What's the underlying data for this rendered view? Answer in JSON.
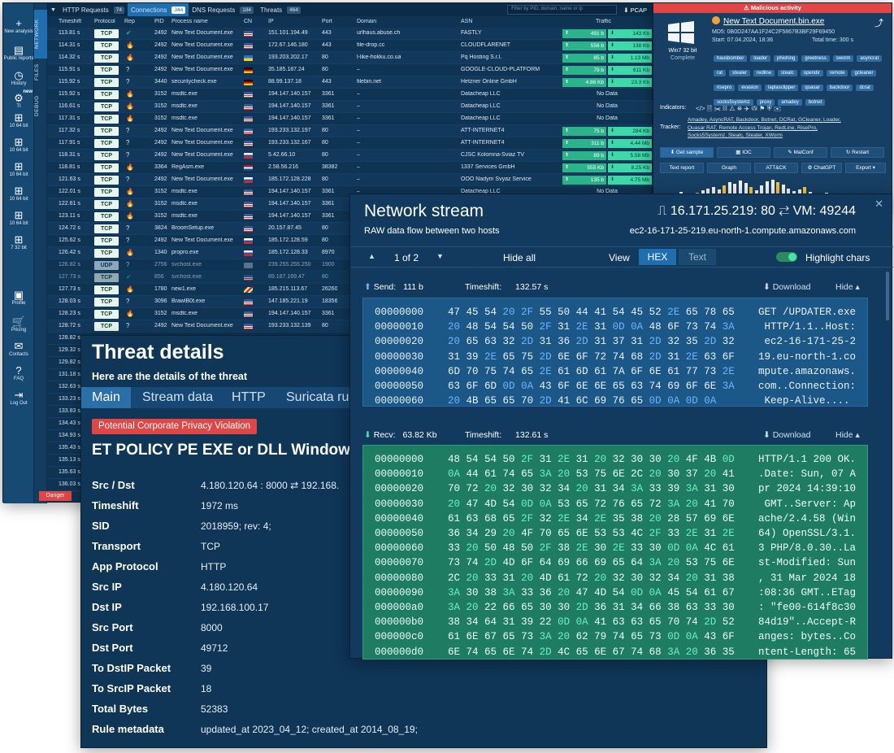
{
  "main": {
    "sidebar": [
      {
        "icon": "+",
        "label": "New analysis"
      },
      {
        "icon": "▤",
        "label": "Public reports"
      },
      {
        "icon": "◷",
        "label": "History"
      },
      {
        "icon": "⚙",
        "label": "TI",
        "badge": "new"
      },
      {
        "icon": "⊞",
        "label": "10 64 bit"
      },
      {
        "icon": "⊞",
        "label": "10 64 bit"
      },
      {
        "icon": "⊞",
        "label": "10 64 bit"
      },
      {
        "icon": "⊞",
        "label": "10 64 bit"
      },
      {
        "icon": "⊞",
        "label": "10 64 bit"
      },
      {
        "icon": "⊞",
        "label": "7 32 bit"
      },
      {
        "icon": "▣",
        "label": "Profile"
      },
      {
        "icon": "🛒",
        "label": "Pricing"
      },
      {
        "icon": "✉",
        "label": "Contacts"
      },
      {
        "icon": "?",
        "label": "FAQ"
      },
      {
        "icon": "⇥",
        "label": "Log Out"
      }
    ],
    "vtabs": [
      "NETWORK",
      "FILES",
      "DEBUG"
    ],
    "tabs": [
      {
        "label": "HTTP Requests",
        "count": "74"
      },
      {
        "label": "Connections",
        "count": "344",
        "active": true
      },
      {
        "label": "DNS Requests",
        "count": "184"
      },
      {
        "label": "Threats",
        "count": "464"
      }
    ],
    "filter_placeholder": "Filter by PID, domain, name or ip",
    "pcap_label": "PCAP",
    "headers": {
      "ts": "Timeshift",
      "proto": "Protocol",
      "rep": "Rep",
      "pid": "PID",
      "proc": "Process name",
      "cn": "CN",
      "ip": "IP",
      "port": "Port",
      "domain": "Domain",
      "asn": "ASN",
      "traffic": "Traffic"
    },
    "rows": [
      {
        "ts": "113.81 s",
        "proto": "TCP",
        "rep": "ok",
        "pid": "2492",
        "proc": "New Text Document.exe",
        "flag": "us",
        "ip": "151.101.194.49",
        "port": "443",
        "domain": "urlhaus.abuse.ch",
        "asn": "FASTLY",
        "up": "491 b",
        "dn": "143 Kb"
      },
      {
        "ts": "114.31 s",
        "proto": "TCP",
        "rep": "bad",
        "pid": "2492",
        "proc": "New Text Document.exe",
        "flag": "us",
        "ip": "172.67.146.180",
        "port": "443",
        "domain": "file-drop.cc",
        "asn": "CLOUDFLARENET",
        "up": "556 b",
        "dn": "138 Kb"
      },
      {
        "ts": "114.32 s",
        "proto": "TCP",
        "rep": "bad",
        "pid": "2492",
        "proc": "New Text Document.exe",
        "flag": "ua",
        "ip": "193.203.202.17",
        "port": "80",
        "domain": "l-like-hokku.co.ua",
        "asn": "Pq Hosting S.r.l.",
        "up": "85 b",
        "dn": "1.13 Mb"
      },
      {
        "ts": "115.91 s",
        "proto": "TCP",
        "rep": "q",
        "pid": "2492",
        "proc": "New Text Document.exe",
        "flag": "de",
        "ip": "35.185.187.24",
        "port": "80",
        "domain": "–",
        "asn": "GOOGLE-CLOUD-PLATFORM",
        "up": "79 b",
        "dn": "611 Kb"
      },
      {
        "ts": "115.92 s",
        "proto": "TCP",
        "rep": "q",
        "pid": "3440",
        "proc": "securitycheck.exe",
        "flag": "de",
        "ip": "88.99.137.18",
        "port": "443",
        "domain": "filebin.net",
        "asn": "Hetzner Online GmbH",
        "up": "4.86 Kb",
        "dn": "23.3 Kb"
      },
      {
        "ts": "115.92 s",
        "proto": "TCP",
        "rep": "bad",
        "pid": "3152",
        "proc": "msdtc.exe",
        "flag": "us",
        "ip": "194.147.140.157",
        "port": "3361",
        "domain": "–",
        "asn": "Datacheap LLC",
        "nodata": "No Data"
      },
      {
        "ts": "116.61 s",
        "proto": "TCP",
        "rep": "bad",
        "pid": "3152",
        "proc": "msdtc.exe",
        "flag": "us",
        "ip": "194.147.140.157",
        "port": "3361",
        "domain": "–",
        "asn": "Datacheap LLC",
        "nodata": "No Data"
      },
      {
        "ts": "117.31 s",
        "proto": "TCP",
        "rep": "bad",
        "pid": "3152",
        "proc": "msdtc.exe",
        "flag": "us",
        "ip": "194.147.140.157",
        "port": "3361",
        "domain": "–",
        "asn": "Datacheap LLC",
        "nodata": "No Data"
      },
      {
        "ts": "117.32 s",
        "proto": "TCP",
        "rep": "q",
        "pid": "2492",
        "proc": "New Text Document.exe",
        "flag": "us",
        "ip": "193.233.132.197",
        "port": "80",
        "domain": "–",
        "asn": "ATT-INTERNET4",
        "up": "75 b",
        "dn": "284 Kb"
      },
      {
        "ts": "117.91 s",
        "proto": "TCP",
        "rep": "q",
        "pid": "2492",
        "proc": "New Text Document.exe",
        "flag": "us",
        "ip": "193.233.132.167",
        "port": "80",
        "domain": "–",
        "asn": "ATT-INTERNET4",
        "up": "311 b",
        "dn": "4.44 Mb"
      },
      {
        "ts": "118.31 s",
        "proto": "TCP",
        "rep": "q",
        "pid": "2492",
        "proc": "New Text Document.exe",
        "flag": "ru",
        "ip": "5.42.66.10",
        "port": "80",
        "domain": "–",
        "asn": "CJSC Kolomna-Sviaz TV",
        "up": "89 b",
        "dn": "5.58 Mb"
      },
      {
        "ts": "118.81 s",
        "proto": "TCP",
        "rep": "bad",
        "pid": "3364",
        "proc": "RegAsm.exe",
        "flag": "nl",
        "ip": "2.58.56.216",
        "port": "38382",
        "domain": "–",
        "asn": "1337 Services GmbH",
        "up": "555 Kb",
        "dn": "8.25 Kb"
      },
      {
        "ts": "121.63 s",
        "proto": "TCP",
        "rep": "q",
        "pid": "2492",
        "proc": "New Text Document.exe",
        "flag": "ru",
        "ip": "185.172.128.228",
        "port": "80",
        "domain": "–",
        "asn": "OOO Nadym Svyaz Service",
        "up": "135 b",
        "dn": "4.75 Mb"
      },
      {
        "ts": "122.01 s",
        "proto": "TCP",
        "rep": "bad",
        "pid": "3152",
        "proc": "msdtc.exe",
        "flag": "us",
        "ip": "194.147.140.157",
        "port": "3361",
        "domain": "–",
        "asn": "Datacheap LLC",
        "nodata": "No Data"
      },
      {
        "ts": "122.61 s",
        "proto": "TCP",
        "rep": "bad",
        "pid": "3152",
        "proc": "msdtc.exe",
        "flag": "us",
        "ip": "194.147.140.157",
        "port": "3361",
        "domain": "",
        "asn": "",
        "nodata": ""
      },
      {
        "ts": "123.11 s",
        "proto": "TCP",
        "rep": "bad",
        "pid": "3152",
        "proc": "msdtc.exe",
        "flag": "us",
        "ip": "194.147.140.157",
        "port": "3361",
        "domain": "",
        "asn": "",
        "nodata": ""
      },
      {
        "ts": "124.72 s",
        "proto": "TCP",
        "rep": "q",
        "pid": "3824",
        "proc": "BroomSetup.exe",
        "flag": "us",
        "ip": "20.157.87.45",
        "port": "80",
        "domain": "",
        "asn": "",
        "nodata": ""
      },
      {
        "ts": "125.62 s",
        "proto": "TCP",
        "rep": "q",
        "pid": "2492",
        "proc": "New Text Document.exe",
        "flag": "ru",
        "ip": "185.172.128.59",
        "port": "80",
        "domain": "",
        "asn": "",
        "nodata": ""
      },
      {
        "ts": "126.42 s",
        "proto": "TCP",
        "rep": "bad",
        "pid": "1340",
        "proc": "propro.exe",
        "flag": "ru",
        "ip": "185.172.128.33",
        "port": "8970",
        "domain": "",
        "asn": "",
        "nodata": ""
      },
      {
        "ts": "126.82 s",
        "proto": "UDP",
        "rep": "q",
        "pid": "2756",
        "proc": "svchost.exe",
        "flag": "unk",
        "ip": "239.255.255.250",
        "port": "1900",
        "domain": "",
        "asn": "",
        "nodata": "",
        "dim": true
      },
      {
        "ts": "127.73 s",
        "proto": "TCP",
        "rep": "ok",
        "pid": "856",
        "proc": "svchost.exe",
        "flag": "us",
        "ip": "89.187.169.47",
        "port": "80",
        "domain": "",
        "asn": "",
        "nodata": "",
        "dim": true
      },
      {
        "ts": "127.73 s",
        "proto": "TCP",
        "rep": "bad",
        "pid": "1780",
        "proc": "new1.exe",
        "flag": "sc",
        "ip": "185.215.113.67",
        "port": "26260",
        "domain": "",
        "asn": "",
        "nodata": ""
      },
      {
        "ts": "128.03 s",
        "proto": "TCP",
        "rep": "q",
        "pid": "3096",
        "proc": "BrawlB0t.exe",
        "flag": "us",
        "ip": "147.185.221.19",
        "port": "18356",
        "domain": "",
        "asn": "",
        "nodata": ""
      },
      {
        "ts": "128.23 s",
        "proto": "TCP",
        "rep": "bad",
        "pid": "3152",
        "proc": "msdtc.exe",
        "flag": "us",
        "ip": "194.147.140.157",
        "port": "3361",
        "domain": "",
        "asn": "",
        "nodata": ""
      },
      {
        "ts": "128.72 s",
        "proto": "TCP",
        "rep": "q",
        "pid": "2492",
        "proc": "New Text Document.exe",
        "flag": "us",
        "ip": "193.233.132.139",
        "port": "80",
        "domain": "",
        "asn": "",
        "nodata": ""
      }
    ],
    "extra_ts": [
      "128.82 s",
      "129.32 s",
      "129.82 s",
      "131.18 s",
      "132.63 s",
      "133.23 s",
      "133.83 s",
      "134.43 s",
      "134.93 s",
      "135.43 s",
      "135.13 s",
      "135.63 s",
      "136.03 s"
    ],
    "danger_label": "Danger"
  },
  "rightpanel": {
    "header": "Malicious activity",
    "os": "Win7 32 bit",
    "status": "Complete",
    "file": "New Text Document.bin.exe",
    "md5": "MD5: 0B0D247AA1F24C2F5867B3BF29F69450",
    "start": "Start: 07.04.2024, 18:36",
    "total": "Total time: 300 s",
    "tags": [
      "hausbomber",
      "loader",
      "phishing",
      "greetness",
      "sworm",
      "asyncrat",
      "rat",
      "stealer",
      "redline",
      "stealc",
      "opendir",
      "remote",
      "gcleaner",
      "risepro",
      "evasion",
      "laplasclipper",
      "quasar",
      "backdoor",
      "dcrat",
      "socks5systemz",
      "proxy",
      "amadey",
      "botnet"
    ],
    "indicators_label": "Indicators:",
    "indicator_icons": "</>  🗎  ✂  ⛓  ⚠  ⛯  ✈  ⛁  ⚑  ⛨  ✉",
    "families": "Amadey, AsyncRAT, Backdoor, Botnet, DCRat, GCleaner, Loader,",
    "tracker_label": "Tracker:",
    "tracker_line1": "Quasar RAT, Remote Access Trojan, RedLine, RisePro,",
    "tracker_line2": "Socks5Systemz, Stealc, Stealer, XWorm",
    "btn": {
      "sample": "Get sample",
      "ioc": "IOC",
      "malconf": "MalConf",
      "restart": "Restart",
      "report": "Text report",
      "graph": "Graph",
      "attck": "ATT&CK",
      "chatgpt": "ChatGPT",
      "export": "Export"
    }
  },
  "stream": {
    "title": "Network stream",
    "subtitle": "RAW data flow between two hosts",
    "endpoint": "16.171.25.219: 80 ⇄ VM: 49244",
    "host": "ec2-16-171-25-219.eu-north-1.compute.amazonaws.com",
    "pager": "1 of 2",
    "hide_all": "Hide all",
    "view": "View",
    "hex": "HEX",
    "text": "Text",
    "highlight": "Highlight chars",
    "send": {
      "label": "Send:",
      "size": "111 b",
      "ts_label": "Timeshift:",
      "ts": "132.57 s",
      "download": "Download",
      "hide": "Hide"
    },
    "recv": {
      "label": "Recv:",
      "size": "63.82 Kb",
      "ts_label": "Timeshift:",
      "ts": "132.61 s",
      "download": "Download",
      "hide": "Hide"
    },
    "send_rows": [
      {
        "off": "00000000",
        "hex": "47 45 54 20 2F 55 50 44 41 54 45 52 2E 65 78 65",
        "txt": "GET /UPDATER.exe"
      },
      {
        "off": "00000010",
        "hex": "20 48 54 54 50 2F 31 2E 31 0D 0A 48 6F 73 74 3A",
        "txt": " HTTP/1.1..Host:"
      },
      {
        "off": "00000020",
        "hex": "20 65 63 32 2D 31 36 2D 31 37 31 2D 32 35 2D 32",
        "txt": " ec2-16-171-25-2"
      },
      {
        "off": "00000030",
        "hex": "31 39 2E 65 75 2D 6E 6F 72 74 68 2D 31 2E 63 6F",
        "txt": "19.eu-north-1.co"
      },
      {
        "off": "00000040",
        "hex": "6D 70 75 74 65 2E 61 6D 61 7A 6F 6E 61 77 73 2E",
        "txt": "mpute.amazonaws."
      },
      {
        "off": "00000050",
        "hex": "63 6F 6D 0D 0A 43 6F 6E 6E 65 63 74 69 6F 6E 3A",
        "txt": "com..Connection:"
      },
      {
        "off": "00000060",
        "hex": "20 4B 65 65 70 2D 41 6C 69 76 65 0D 0A 0D 0A",
        "txt": " Keep-Alive...."
      }
    ],
    "recv_rows": [
      {
        "off": "00000000",
        "hex": "48 54 54 50 2F 31 2E 31 20 32 30 30 20 4F 4B 0D",
        "txt": "HTTP/1.1 200 OK."
      },
      {
        "off": "00000010",
        "hex": "0A 44 61 74 65 3A 20 53 75 6E 2C 20 30 37 20 41",
        "txt": ".Date: Sun, 07 A"
      },
      {
        "off": "00000020",
        "hex": "70 72 20 32 30 32 34 20 31 34 3A 33 39 3A 31 30",
        "txt": "pr 2024 14:39:10"
      },
      {
        "off": "00000030",
        "hex": "20 47 4D 54 0D 0A 53 65 72 76 65 72 3A 20 41 70",
        "txt": " GMT..Server: Ap"
      },
      {
        "off": "00000040",
        "hex": "61 63 68 65 2F 32 2E 34 2E 35 38 20 28 57 69 6E",
        "txt": "ache/2.4.58 (Win"
      },
      {
        "off": "00000050",
        "hex": "36 34 29 20 4F 70 65 6E 53 53 4C 2F 33 2E 31 2E",
        "txt": "64) OpenSSL/3.1."
      },
      {
        "off": "00000060",
        "hex": "33 20 50 48 50 2F 38 2E 30 2E 33 30 0D 0A 4C 61",
        "txt": "3 PHP/8.0.30..La"
      },
      {
        "off": "00000070",
        "hex": "73 74 2D 4D 6F 64 69 66 69 65 64 3A 20 53 75 6E",
        "txt": "st-Modified: Sun"
      },
      {
        "off": "00000080",
        "hex": "2C 20 33 31 20 4D 61 72 20 32 30 32 34 20 31 38",
        "txt": ", 31 Mar 2024 18"
      },
      {
        "off": "00000090",
        "hex": "3A 30 38 3A 33 36 20 47 4D 54 0D 0A 45 54 61 67",
        "txt": ":08:36 GMT..ETag"
      },
      {
        "off": "000000a0",
        "hex": "3A 20 22 66 65 30 30 2D 36 31 34 66 38 63 33 30",
        "txt": ": \"fe00-614f8c30"
      },
      {
        "off": "000000b0",
        "hex": "38 34 64 31 39 22 0D 0A 41 63 63 65 70 74 2D 52",
        "txt": "84d19\"..Accept-R"
      },
      {
        "off": "000000c0",
        "hex": "61 6E 67 65 73 3A 20 62 79 74 65 73 0D 0A 43 6F",
        "txt": "anges: bytes..Co"
      },
      {
        "off": "000000d0",
        "hex": "6E 74 65 6E 74 2D 4C 65 6E 67 74 68 3A 20 36 35",
        "txt": "ntent-Length: 65"
      }
    ]
  },
  "threat": {
    "title": "Threat details",
    "subtitle": "Here are the details of the threat",
    "tabs": [
      "Main",
      "Stream data",
      "HTTP",
      "Suricata ru"
    ],
    "badge": "Potential Corporate Privacy Violation",
    "rule": "ET POLICY PE EXE or DLL Windows",
    "fields": [
      {
        "k": "Src / Dst",
        "v": "4.180.120.64 : 8000  ⇄  192.168."
      },
      {
        "k": "Timeshift",
        "v": "1972 ms"
      },
      {
        "k": "SID",
        "v": "2018959; rev: 4;"
      },
      {
        "k": "Transport",
        "v": "TCP"
      },
      {
        "k": "App Protocol",
        "v": "HTTP"
      },
      {
        "k": "Src IP",
        "v": "4.180.120.64"
      },
      {
        "k": "Dst IP",
        "v": "192.168.100.17"
      },
      {
        "k": "Src Port",
        "v": "8000"
      },
      {
        "k": "Dst Port",
        "v": "49712"
      },
      {
        "k": "To DstIP Packet",
        "v": "39"
      },
      {
        "k": "To SrcIP Packet",
        "v": "18"
      },
      {
        "k": "Total Bytes",
        "v": "52383"
      },
      {
        "k": "Rule metadata",
        "v": "updated_at 2023_04_12; created_at 2014_08_19;"
      }
    ]
  },
  "colors": {
    "accent": "#1f6fb0",
    "danger": "#e04646",
    "recv_bg": "#1f7a63",
    "send_bg": "#1d5a8a",
    "tag": "#2f6ca2"
  }
}
